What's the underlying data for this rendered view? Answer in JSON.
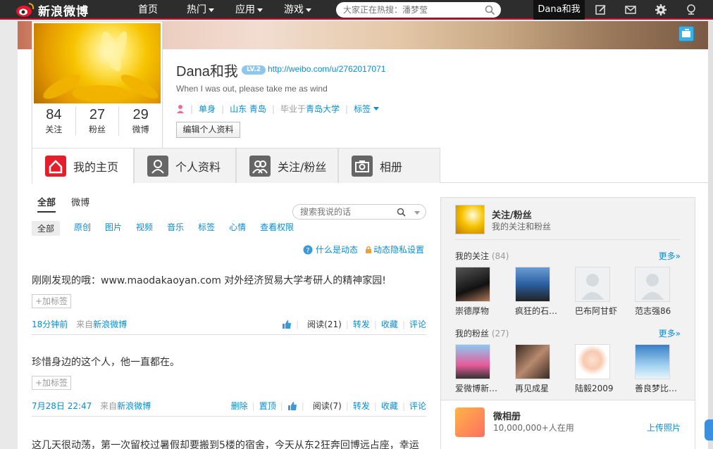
{
  "topbar": {
    "logo_text": "新浪微博",
    "nav": [
      "首页",
      "热门",
      "应用",
      "游戏"
    ],
    "search_placeholder": "大家正在热搜：潘梦莹",
    "username": "Dana和我"
  },
  "profile": {
    "name": "Dana和我",
    "level_badge": "LV.2",
    "url": "http://weibo.com/u/2762017071",
    "bio": "When I was out, please take me as wind",
    "status": "单身",
    "location": "山东 青岛",
    "school_prefix": "毕业于",
    "school": "青岛大学",
    "tags": "标签",
    "edit_button": "编辑个人资料",
    "stats": [
      {
        "num": "84",
        "label": "关注"
      },
      {
        "num": "27",
        "label": "粉丝"
      },
      {
        "num": "29",
        "label": "微博"
      }
    ]
  },
  "tabs": [
    "我的主页",
    "个人资料",
    "关注/粉丝",
    "相册"
  ],
  "feed": {
    "tabs": [
      "全部",
      "微博"
    ],
    "search_placeholder": "搜索我说的话",
    "filters": [
      "全部",
      "原创",
      "图片",
      "视频",
      "音乐",
      "标签",
      "心情",
      "查看权限"
    ],
    "help_link": "什么是动态",
    "privacy_link": "动态隐私设置",
    "posts": [
      {
        "text": "刚刚发现的哦：www.maodakaoyan.com 对外经济贸易大学考研人的精神家园!",
        "tag_button": "+加标签",
        "time": "18分钟前",
        "source_prefix": "来自",
        "source": "新浪微博",
        "actions": [
          "阅读(21)",
          "转发",
          "收藏",
          "评论"
        ]
      },
      {
        "text": "珍惜身边的这个人，他一直都在。",
        "tag_button": "+加标签",
        "time": "7月28日 22:47",
        "source_prefix": "来自",
        "source": "新浪微博",
        "actions": [
          "删除",
          "置顶",
          "阅读(7)",
          "转发",
          "收藏",
          "评论"
        ]
      },
      {
        "text": "这几天很动荡，第一次留校过暑假却要搬到5楼的宿舍，今天从东2狂奔回博远占座，幸运"
      }
    ]
  },
  "sidebar": {
    "title": "关注/粉丝",
    "subtitle": "我的关注和粉丝",
    "following_title": "我的关注",
    "following_count": "(84)",
    "followers_title": "我的粉丝",
    "followers_count": "(27)",
    "more": "更多»",
    "following": [
      "崇德厚物",
      "疯狂的石…",
      "巴布阿甘虾",
      "范志强86"
    ],
    "followers": [
      "爱微博新…",
      "再见成星",
      "陆毅2009",
      "善良梦比…"
    ],
    "album_title": "微相册",
    "album_sub": "10,000,000+人在用",
    "album_link": "上传照片"
  }
}
